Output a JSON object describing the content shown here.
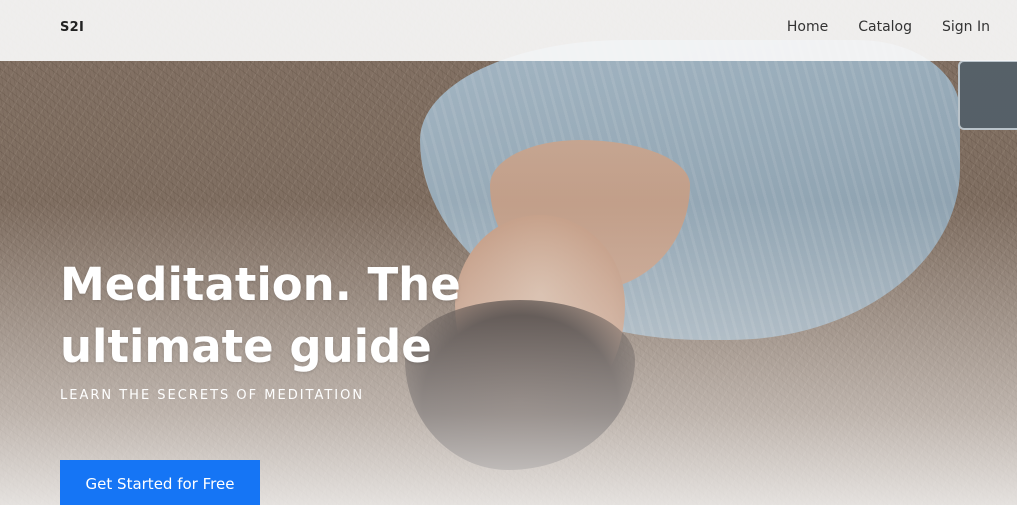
{
  "header": {
    "brand": "S2I",
    "nav": [
      {
        "label": "Home"
      },
      {
        "label": "Catalog"
      },
      {
        "label": "Sign In"
      }
    ]
  },
  "hero": {
    "title": "Meditation. The ultimate guide",
    "subtitle": "LEARN THE SECRETS OF MEDITATION",
    "cta_label": "Get Started for Free",
    "image_alt": "Woman lying on grass meditating"
  },
  "colors": {
    "accent": "#1575f5",
    "navbar_bg": "#f8f8f8",
    "hero_text": "#ffffff"
  }
}
